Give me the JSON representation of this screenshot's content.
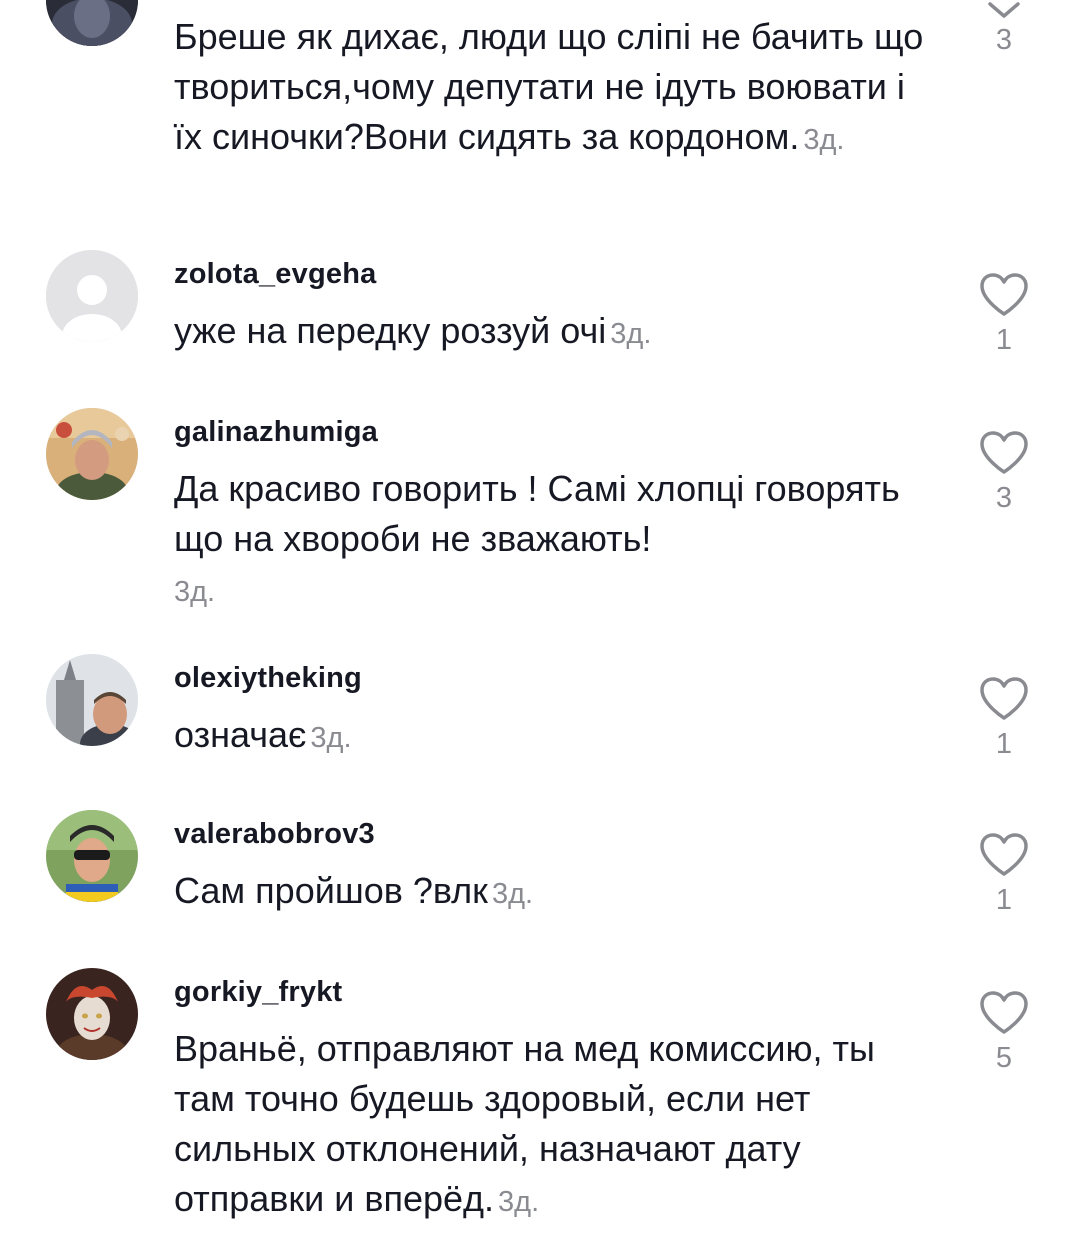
{
  "comments": [
    {
      "username": "",
      "text": "Бреше як дихає, люди що сліпі не бачить що твориться,чому депутати не ідуть воювати і їх синочки?Вони сидять за кордоном.",
      "time": "3д.",
      "likes": "3"
    },
    {
      "username": "zolota_evgeha",
      "text": "уже на передку роззуй очі",
      "time": "3д.",
      "likes": "1"
    },
    {
      "username": "galinazhumiga",
      "text": "Да красиво говорить ! Самі хлопці говорять що на хвороби не зважають!",
      "time": "3д.",
      "likes": "3"
    },
    {
      "username": "olexiytheking",
      "text": "означає",
      "time": "3д.",
      "likes": "1"
    },
    {
      "username": "valerabobrov3",
      "text": "Сам пройшов ?влк",
      "time": "3д.",
      "likes": "1"
    },
    {
      "username": "gorkiy_frykt",
      "text": "Враньё, отправляют на мед комиссию, ты там точно будешь здоровый, если нет сильных отклонений, назначают дату отправки и вперёд.",
      "time": "3д.",
      "likes": "5"
    }
  ],
  "icons": {
    "like": "heart-outline-icon",
    "expand": "chevron-down-icon",
    "default_avatar": "default-avatar-icon"
  },
  "colors": {
    "text": "#161823",
    "muted": "#8a8b91",
    "icon": "#8a8b91"
  }
}
